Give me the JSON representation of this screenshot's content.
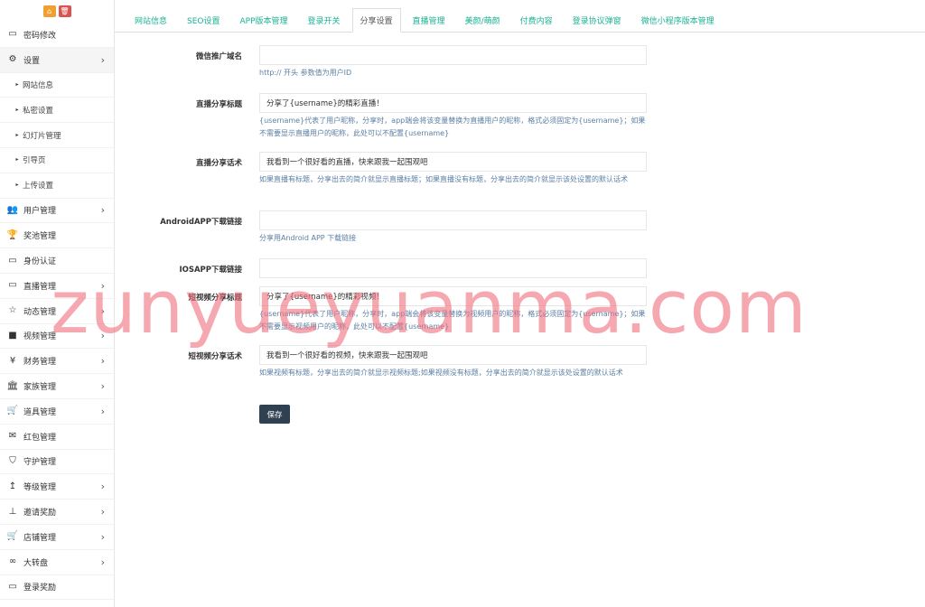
{
  "sidebar": {
    "top_buttons": [
      {
        "icon": "home-icon",
        "glyph": "⌂",
        "color": "#f0a030"
      },
      {
        "icon": "trash-icon",
        "glyph": "🗑",
        "color": "#d9534f"
      }
    ],
    "items": [
      {
        "label": "密码修改",
        "icon": "monitor-icon",
        "glyph": "▭"
      },
      {
        "label": "设置",
        "icon": "gears-icon",
        "glyph": "⚙",
        "chev": "›"
      },
      {
        "label": "网站信息",
        "sub": true,
        "glyph": "▸"
      },
      {
        "label": "私密设置",
        "sub": true,
        "glyph": "▸"
      },
      {
        "label": "幻灯片管理",
        "sub": true,
        "glyph": "▸"
      },
      {
        "label": "引导页",
        "sub": true,
        "glyph": "▸"
      },
      {
        "label": "上传设置",
        "sub": true,
        "glyph": "▸"
      },
      {
        "label": "用户管理",
        "icon": "users-icon",
        "glyph": "👥",
        "chev": "›"
      },
      {
        "label": "奖池管理",
        "icon": "trophy-icon",
        "glyph": "🏆"
      },
      {
        "label": "身份认证",
        "icon": "monitor-icon",
        "glyph": "▭"
      },
      {
        "label": "直播管理",
        "icon": "monitor-icon",
        "glyph": "▭",
        "chev": "›"
      },
      {
        "label": "动态管理",
        "icon": "star-icon",
        "glyph": "☆",
        "chev": "›"
      },
      {
        "label": "视频管理",
        "icon": "video-icon",
        "glyph": "■",
        "chev": "›"
      },
      {
        "label": "财务管理",
        "icon": "yen-icon",
        "glyph": "¥",
        "chev": "›"
      },
      {
        "label": "家族管理",
        "icon": "bank-icon",
        "glyph": "🏛",
        "chev": "›"
      },
      {
        "label": "道具管理",
        "icon": "cart-icon",
        "glyph": "🛒",
        "chev": "›"
      },
      {
        "label": "红包管理",
        "icon": "envelope-icon",
        "glyph": "✉"
      },
      {
        "label": "守护管理",
        "icon": "shield-icon",
        "glyph": "⛉"
      },
      {
        "label": "等级管理",
        "icon": "level-up-icon",
        "glyph": "↥",
        "chev": "›"
      },
      {
        "label": "邀请奖励",
        "icon": "sitemap-icon",
        "glyph": "⊥",
        "chev": "›"
      },
      {
        "label": "店铺管理",
        "icon": "cart-icon",
        "glyph": "🛒",
        "chev": "›"
      },
      {
        "label": "大转盘",
        "icon": "gamepad-icon",
        "glyph": "∞",
        "chev": "›"
      },
      {
        "label": "登录奖励",
        "icon": "monitor-icon",
        "glyph": "▭"
      }
    ]
  },
  "tabs": [
    {
      "label": "网站信息"
    },
    {
      "label": "SEO设置"
    },
    {
      "label": "APP版本管理"
    },
    {
      "label": "登录开关"
    },
    {
      "label": "分享设置",
      "active": true
    },
    {
      "label": "直播管理"
    },
    {
      "label": "美颜/萌颜"
    },
    {
      "label": "付费内容"
    },
    {
      "label": "登录协议弹窗"
    },
    {
      "label": "微信小程序版本管理"
    }
  ],
  "form": {
    "wx_domain": {
      "label": "微信推广域名",
      "value": "",
      "help": "http:// 开头 参数值为用户ID"
    },
    "live_title": {
      "label": "直播分享标题",
      "value": "分享了{username}的精彩直播！",
      "help": "{username}代表了用户昵称，分享时，app端会将该变量替换为直播用户的昵称，格式必须固定为{username}；如果不需要显示直播用户的昵称，此处可以不配置{username}"
    },
    "live_desc": {
      "label": "直播分享话术",
      "value": "我看到一个很好看的直播，快来跟我一起围观吧",
      "help": "如果直播有标题，分享出去的简介就显示直播标题；如果直播没有标题，分享出去的简介就显示该处设置的默认话术"
    },
    "android_link": {
      "label": "AndroidAPP下载链接",
      "value": "",
      "help": "分享用Android APP 下载链接"
    },
    "ios_link": {
      "label": "IOSAPP下载链接",
      "value": ""
    },
    "video_title": {
      "label": "短视频分享标题",
      "value": "分享了{username}的精彩视频！",
      "help": "{username}代表了用户昵称，分享时，app端会将该变量替换为视频用户的昵称，格式必须固定为{username}；如果不需要显示视频用户的昵称，此处可以不配置{username}"
    },
    "video_desc": {
      "label": "短视频分享话术",
      "value": "我看到一个很好看的视频，快来跟我一起围观吧",
      "help": "如果视频有标题，分享出去的简介就显示视频标题;如果视频没有标题，分享出去的简介就显示该处设置的默认话术"
    },
    "save_label": "保存"
  },
  "watermark": "zunyueyuanma.com"
}
